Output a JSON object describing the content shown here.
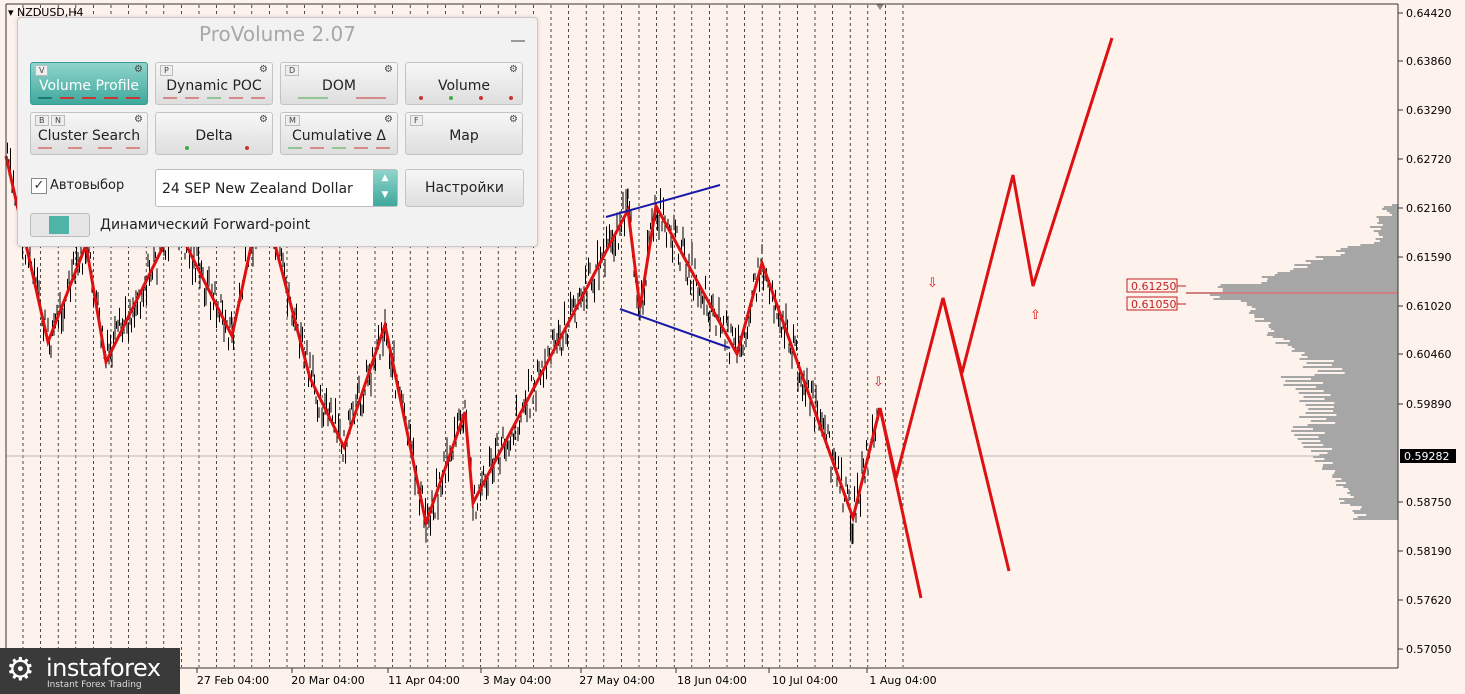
{
  "symbol": "NZDUSD,H4",
  "panel": {
    "title": "ProVolume 2.07",
    "tiles": [
      {
        "key": "V",
        "label": "Volume Profile",
        "active": true
      },
      {
        "key": "P",
        "label": "Dynamic POC",
        "active": false
      },
      {
        "key": "D",
        "label": "DOM",
        "active": false
      },
      {
        "key": "",
        "label": "Volume",
        "active": false
      },
      {
        "key": "B",
        "key2": "N",
        "label": "Cluster Search",
        "active": false
      },
      {
        "key": "",
        "label": "Delta",
        "active": false
      },
      {
        "key": "M",
        "label": "Cumulative Δ",
        "active": false
      },
      {
        "key": "F",
        "label": "Map",
        "active": false
      }
    ],
    "autoselect_label": "Автовыбор",
    "instrument": "24 SEP New Zealand Dollar",
    "settings_button": "Настройки",
    "forward_label": "Динамический Forward-point"
  },
  "price_axis": [
    "0.64420",
    "0.63860",
    "0.63290",
    "0.62720",
    "0.62160",
    "0.61590",
    "0.61020",
    "0.60460",
    "0.59890",
    "0.59282",
    "0.58750",
    "0.58190",
    "0.57620",
    "0.57050"
  ],
  "time_axis": [
    "27 Feb 04:00",
    "20 Mar 04:00",
    "11 Apr 04:00",
    "3 May 04:00",
    "27 May 04:00",
    "18 Jun 04:00",
    "10 Jul 04:00",
    "1 Aug 04:00"
  ],
  "current_price": "0.59282",
  "levels": [
    "0.61250",
    "0.61050"
  ],
  "colors": {
    "red": "#dd1111",
    "blue": "#1a1aa8",
    "background": "#fdf2ec",
    "profile": "#a6a6a6"
  },
  "logo": {
    "name": "instaforex",
    "tagline": "Instant Forex Trading"
  }
}
